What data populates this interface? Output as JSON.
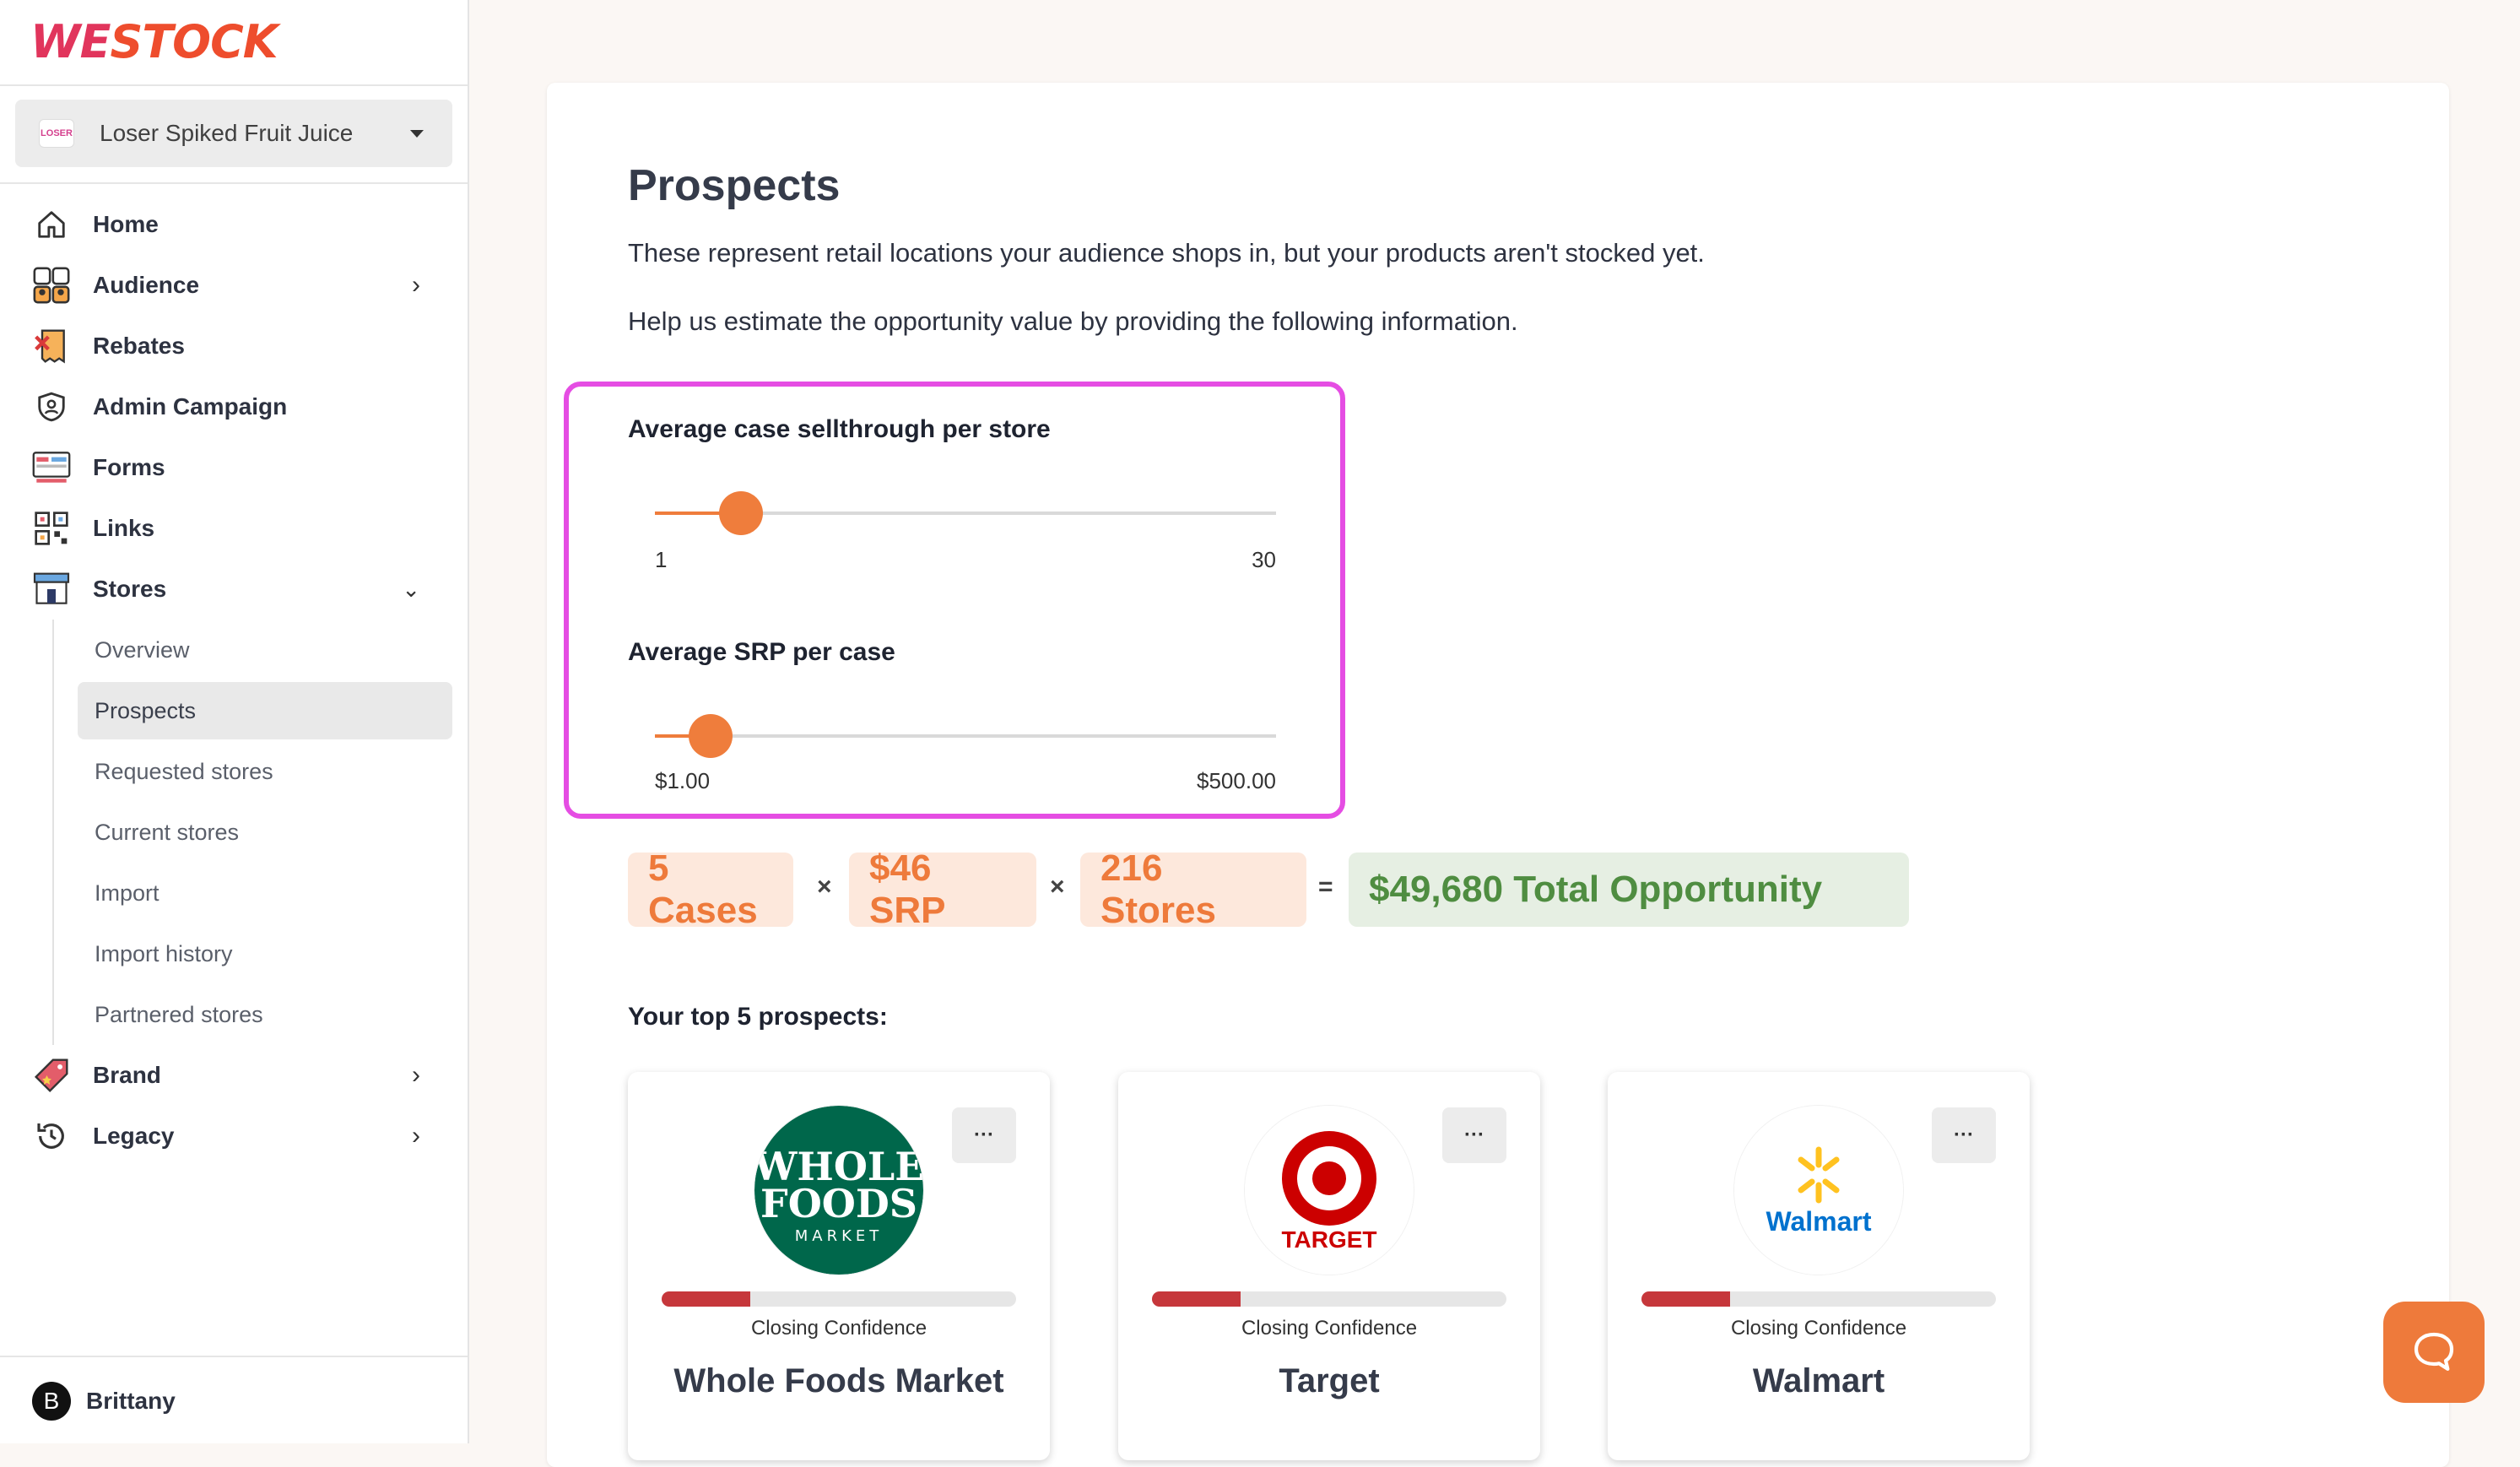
{
  "app": {
    "logo_text_we": "WE",
    "logo_text_rest": "STOCK"
  },
  "brand_selector": {
    "value": "Loser Spiked Fruit Juice",
    "thumb_text": "LOSER"
  },
  "nav": {
    "items": [
      {
        "label": "Home"
      },
      {
        "label": "Audience"
      },
      {
        "label": "Rebates"
      },
      {
        "label": "Admin Campaign"
      },
      {
        "label": "Forms"
      },
      {
        "label": "Links"
      },
      {
        "label": "Stores"
      }
    ],
    "stores_sub": [
      {
        "label": "Overview"
      },
      {
        "label": "Prospects"
      },
      {
        "label": "Requested stores"
      },
      {
        "label": "Current stores"
      },
      {
        "label": "Import"
      },
      {
        "label": "Import history"
      },
      {
        "label": "Partnered stores"
      }
    ],
    "after": [
      {
        "label": "Brand"
      },
      {
        "label": "Legacy"
      }
    ]
  },
  "user": {
    "initial": "B",
    "name": "Brittany"
  },
  "page": {
    "title": "Prospects",
    "description1": "These represent retail locations your audience shops in, but your products aren't stocked yet.",
    "description2": "Help us estimate the opportunity value by providing the following information."
  },
  "sliders": {
    "sellthrough": {
      "label": "Average case sellthrough per store",
      "min_label": "1",
      "max_label": "30",
      "min": 1,
      "max": 30,
      "value": 5
    },
    "srp": {
      "label": "Average SRP per case",
      "min_label": "$1.00",
      "max_label": "$500.00",
      "min": 1,
      "max": 500,
      "value": 46
    }
  },
  "formula": {
    "cases": "5 Cases",
    "srp": "$46 SRP",
    "stores": "216 Stores",
    "times": "×",
    "equals": "=",
    "total": "$49,680 Total Opportunity"
  },
  "colors": {
    "accent": "#ef7d3c",
    "highlight": "#e54de3",
    "positive": "#4f8d41",
    "confidence": "#c6373b"
  },
  "prospects": {
    "heading": "Your top 5 prospects:",
    "more_label": "···",
    "confidence_label": "Closing Confidence",
    "cards": [
      {
        "name": "Whole Foods Market",
        "confidence": 0.25,
        "logo_line1": "WHOLE",
        "logo_line2": "FOODS",
        "logo_line3": "MARKET"
      },
      {
        "name": "Target",
        "confidence": 0.25,
        "logo_text": "TARGET"
      },
      {
        "name": "Walmart",
        "confidence": 0.25,
        "logo_text": "Walmart"
      }
    ]
  }
}
